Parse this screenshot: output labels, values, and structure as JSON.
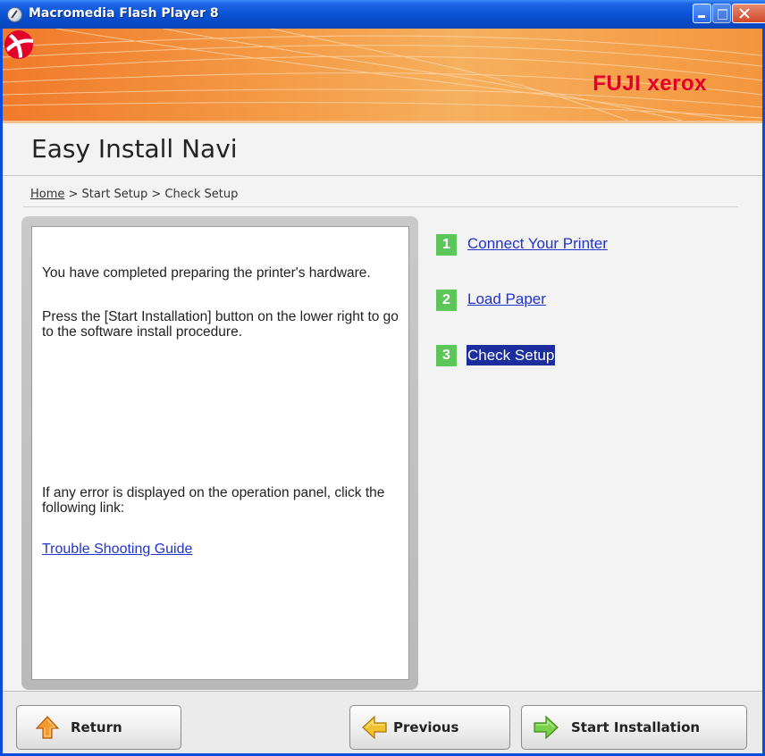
{
  "window": {
    "title": "Macromedia Flash Player 8",
    "controls": [
      "minimize",
      "maximize",
      "close"
    ]
  },
  "banner": {
    "brand": "FUJI xerox",
    "colors": {
      "brand_red": "#e3002b",
      "banner_orange": "#f28a35"
    }
  },
  "app": {
    "title": "Easy Install Navi"
  },
  "breadcrumb": {
    "home": "Home",
    "rest": " > Start Setup > Check Setup"
  },
  "info": {
    "line1": "You have completed preparing the printer's hardware.",
    "line2": "Press the [Start Installation] button on the lower right to go to the software install procedure.",
    "error_text": "If any error is displayed on the operation panel, click the following link:",
    "link": "Trouble Shooting Guide"
  },
  "steps": [
    {
      "num": "1",
      "label": "Connect Your Printer",
      "active": false
    },
    {
      "num": "2",
      "label": "Load Paper",
      "active": false
    },
    {
      "num": "3",
      "label": "Check Setup",
      "active": true
    }
  ],
  "footer": {
    "return_label": "Return",
    "previous_label": "Previous",
    "start_label": "Start Installation",
    "icons": {
      "return": "up-arrow-icon",
      "previous": "left-arrow-icon",
      "start": "right-arrow-icon"
    }
  }
}
